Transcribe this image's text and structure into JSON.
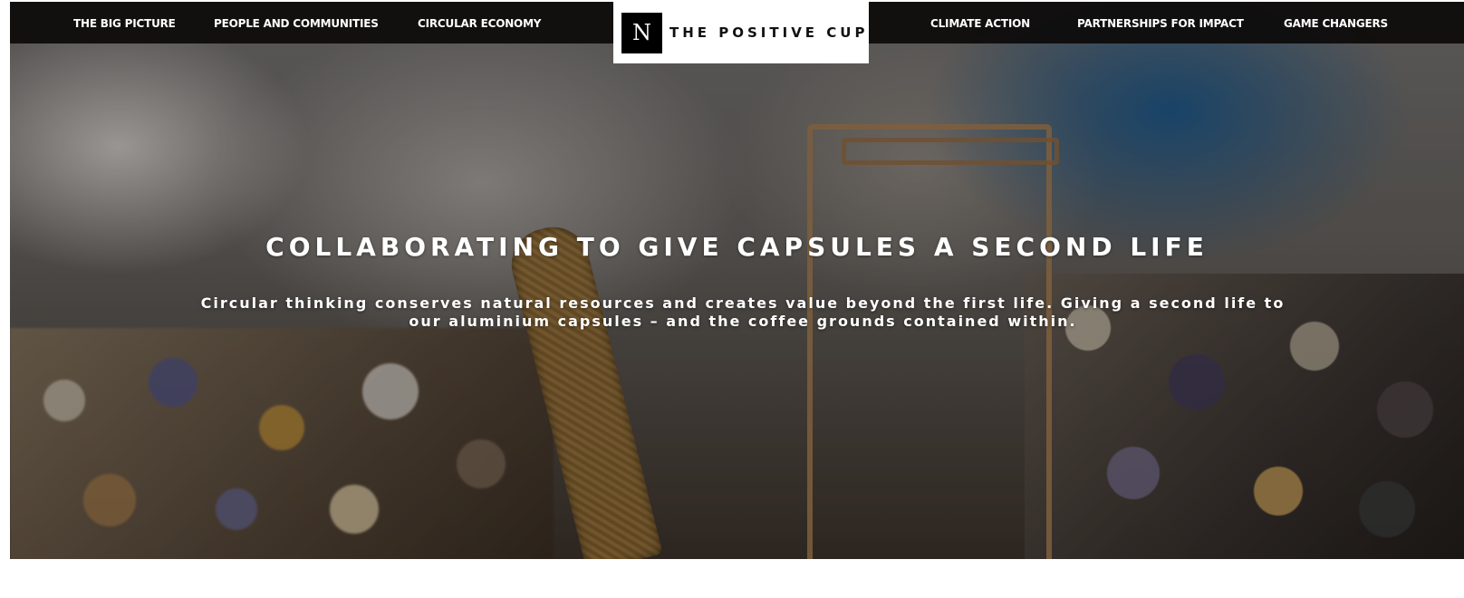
{
  "nav": {
    "left_items": [
      {
        "label": "THE BIG PICTURE"
      },
      {
        "label": "PEOPLE AND COMMUNITIES"
      },
      {
        "label": "CIRCULAR ECONOMY"
      }
    ],
    "right_items": [
      {
        "label": "CLIMATE ACTION"
      },
      {
        "label": "PARTNERSHIPS FOR IMPACT"
      },
      {
        "label": "GAME CHANGERS"
      }
    ]
  },
  "logo": {
    "mark": "N",
    "text": "THE POSITIVE CUP"
  },
  "hero": {
    "title": "COLLABORATING TO GIVE CAPSULES A SECOND LIFE",
    "subtitle": "Circular thinking conserves natural resources and creates value beyond the first life. Giving a second life to our aluminium capsules – and the coffee grounds contained within."
  },
  "colors": {
    "nav_background": "#0c0a09",
    "nav_text": "#ffffff",
    "logo_background": "#ffffff",
    "hero_text": "#ffffff"
  }
}
